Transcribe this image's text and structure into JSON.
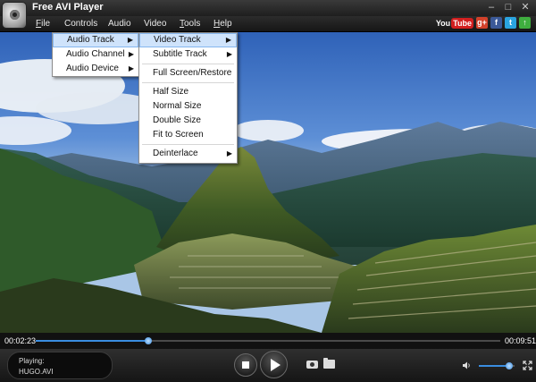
{
  "app": {
    "title": "Free AVI Player"
  },
  "menubar": {
    "items": [
      {
        "label": "File",
        "underline": "F",
        "rest": "ile"
      },
      {
        "label": "Controls"
      },
      {
        "label": "Audio"
      },
      {
        "label": "Video"
      },
      {
        "label": "Tools",
        "underline": "T",
        "rest": "ools"
      },
      {
        "label": "Help",
        "underline": "H",
        "rest": "elp"
      }
    ]
  },
  "socials": {
    "youtube_left": "You",
    "youtube_right": "Tube",
    "gplus": "g+",
    "facebook": "f",
    "twitter": "t"
  },
  "audio_menu": {
    "items": [
      "Audio Track",
      "Audio Channel",
      "Audio Device"
    ]
  },
  "video_menu": {
    "items": [
      "Video Track",
      "Subtitle Track",
      "Full Screen/Restore",
      "Half Size",
      "Normal Size",
      "Double Size",
      "Fit to Screen",
      "Deinterlace"
    ]
  },
  "playback": {
    "current_time": "00:02:23",
    "total_time": "00:09:51",
    "progress": 0.243,
    "volume": 0.85
  },
  "now_playing": {
    "label": "Playing:",
    "file": "HUGO.AVI"
  },
  "colors": {
    "accent": "#3a8de0",
    "menu_highlight": "#cfe3fb"
  }
}
